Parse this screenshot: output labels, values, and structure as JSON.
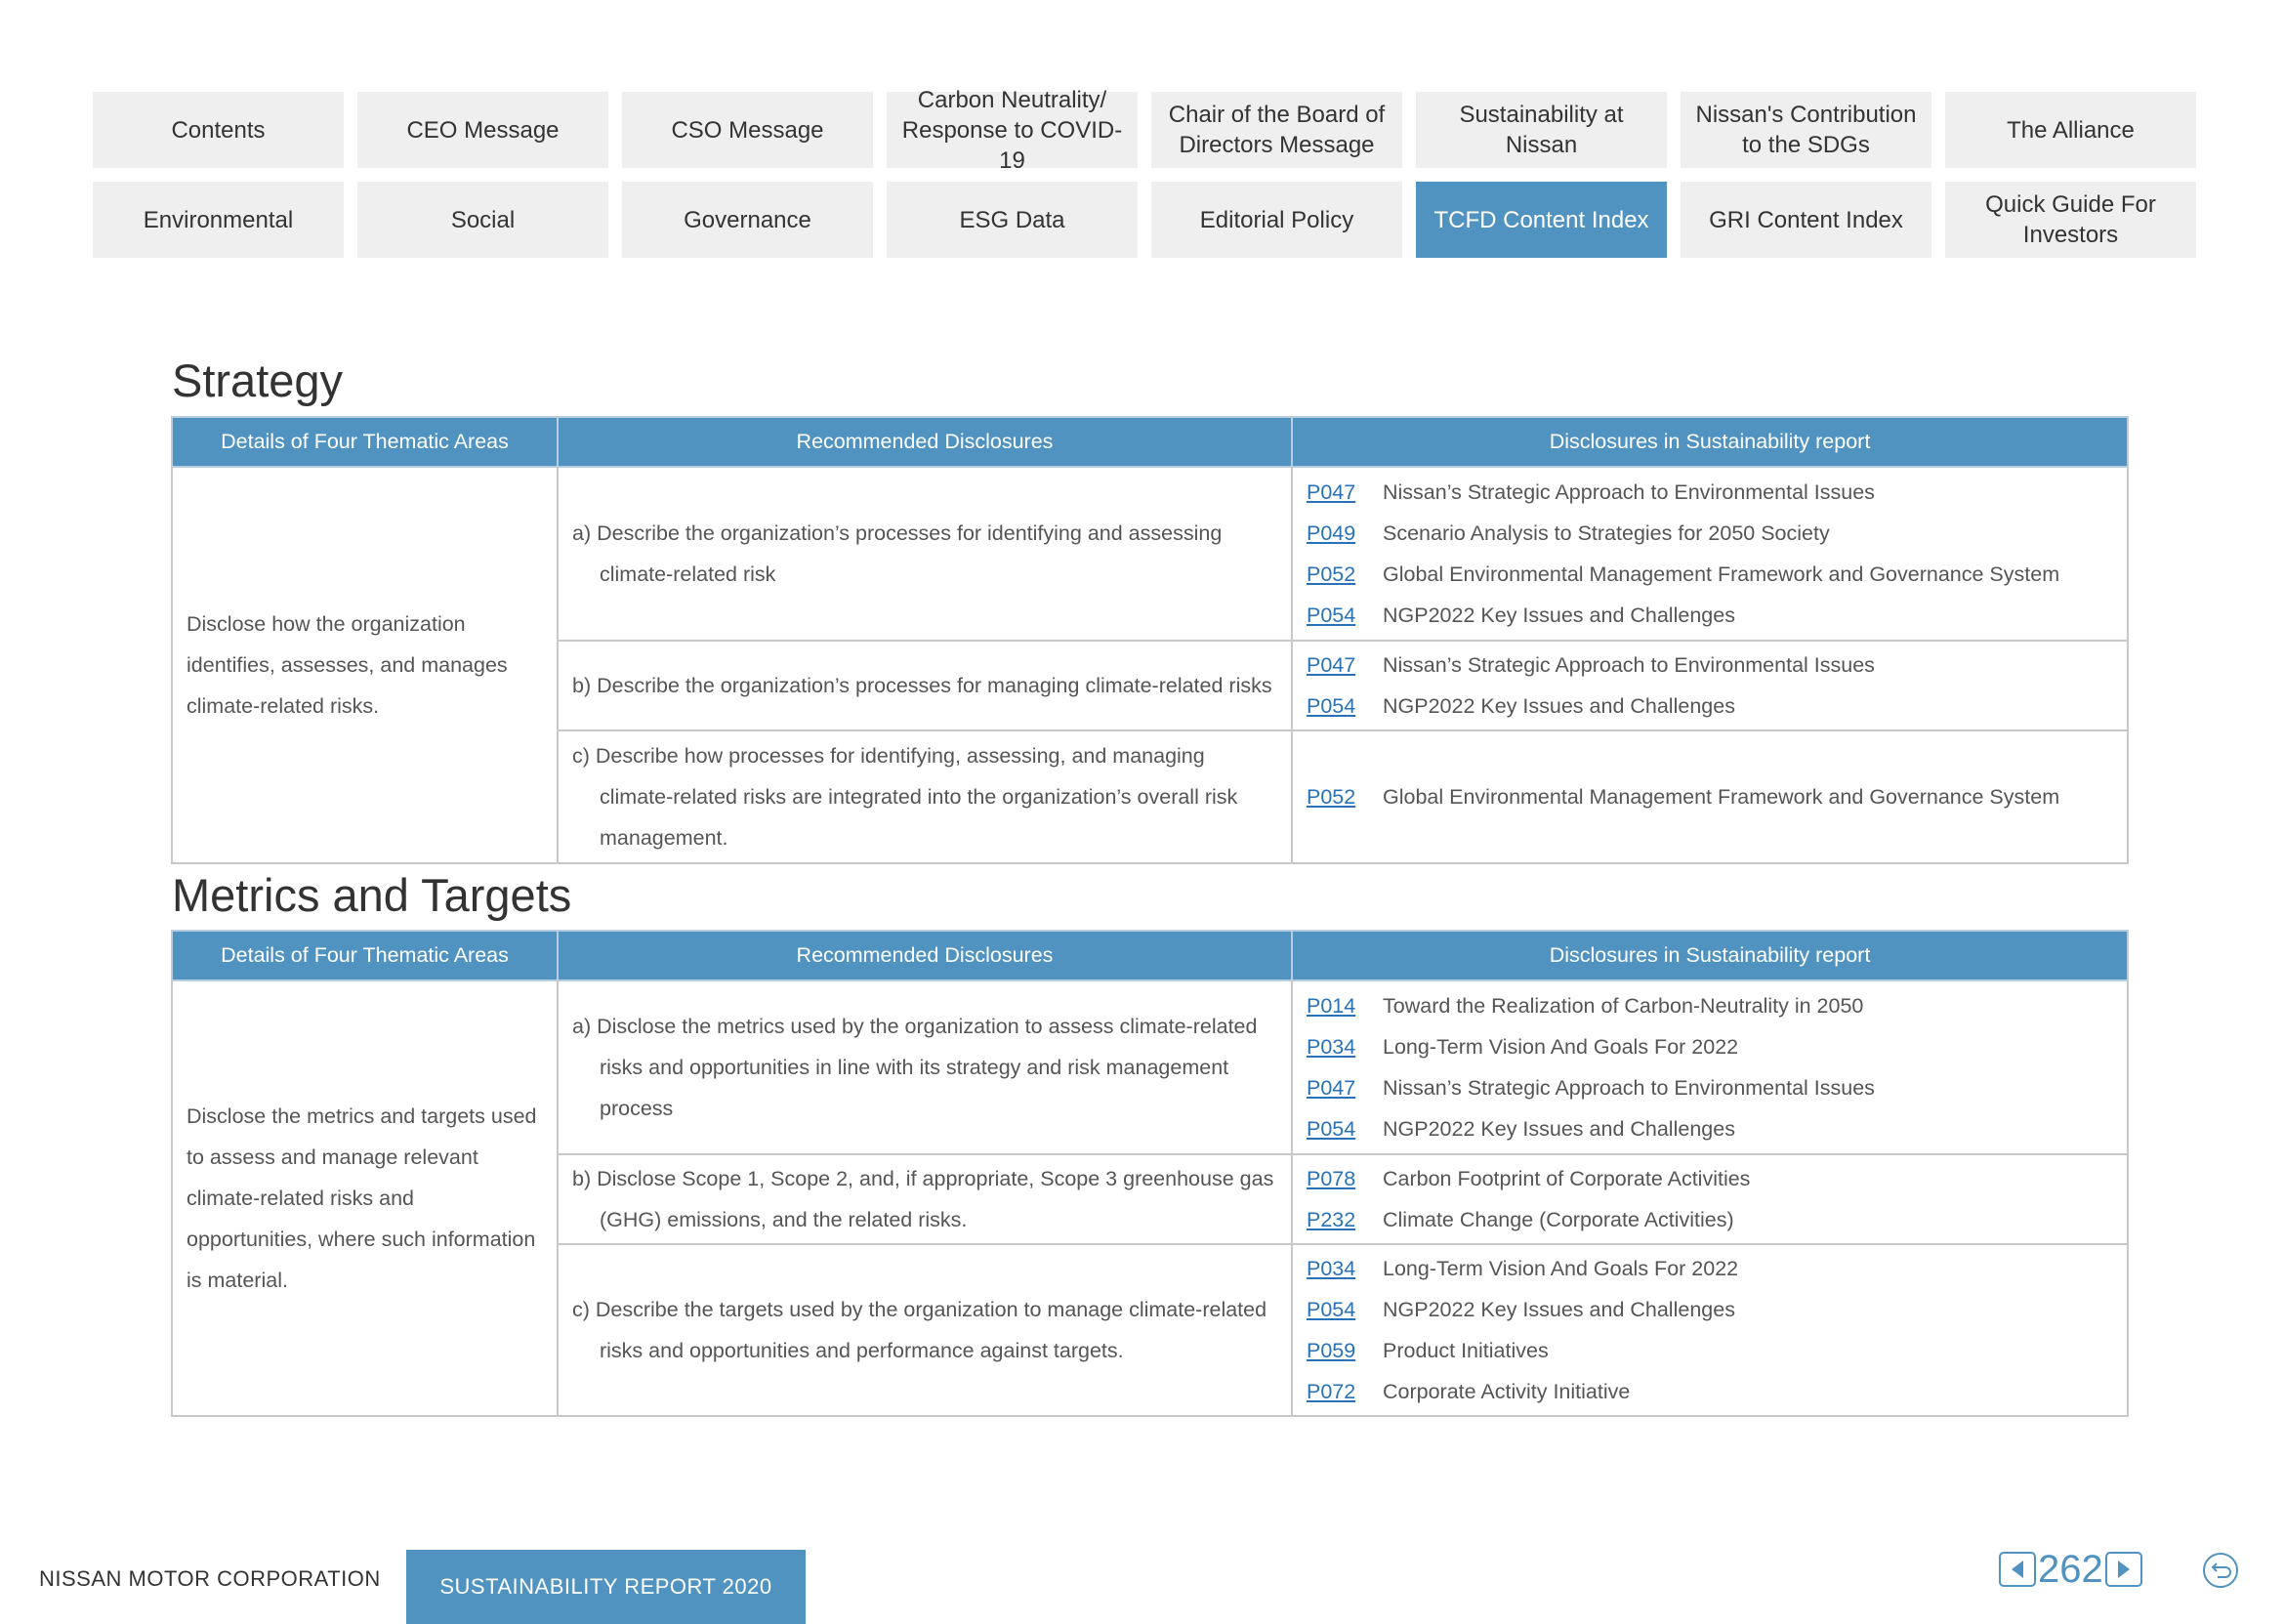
{
  "nav": {
    "row1": [
      "Contents",
      "CEO Message",
      "CSO Message",
      "Carbon Neutrality/\nResponse to COVID-19",
      "Chair of the Board of\nDirectors Message",
      "Sustainability at Nissan",
      "Nissan's Contribution\nto the SDGs",
      "The Alliance"
    ],
    "row2": [
      "Environmental",
      "Social",
      "Governance",
      "ESG Data",
      "Editorial Policy",
      "TCFD Content Index",
      "GRI Content Index",
      "Quick Guide For\nInvestors"
    ],
    "active": "TCFD Content Index"
  },
  "headers": {
    "col1": "Details of Four Thematic Areas",
    "col2": "Recommended Disclosures",
    "col3": "Disclosures in Sustainability report"
  },
  "strategy": {
    "title": "Strategy",
    "area": "Disclose how the organization identifies, assesses, and manages climate-related risks.",
    "rows": [
      {
        "rec": "a) Describe the organization’s processes for identifying and assessing climate-related risk",
        "refs": [
          {
            "code": "P047",
            "text": "Nissan’s Strategic Approach to Environmental Issues"
          },
          {
            "code": "P049",
            "text": "Scenario Analysis to Strategies for 2050 Society"
          },
          {
            "code": "P052",
            "text": "Global Environmental Management Framework and Governance System"
          },
          {
            "code": "P054",
            "text": "NGP2022 Key Issues and Challenges"
          }
        ]
      },
      {
        "rec": "b) Describe the organization’s processes for managing climate-related risks",
        "refs": [
          {
            "code": "P047",
            "text": "Nissan’s Strategic Approach to Environmental Issues"
          },
          {
            "code": "P054",
            "text": "NGP2022 Key Issues and Challenges"
          }
        ]
      },
      {
        "rec": "c) Describe how processes for identifying, assessing, and managing climate-related risks are integrated into the organization’s overall risk management.",
        "refs": [
          {
            "code": "P052",
            "text": "Global Environmental Management Framework and Governance System"
          }
        ]
      }
    ]
  },
  "metrics": {
    "title": "Metrics and Targets",
    "area": "Disclose the metrics and targets used to assess and manage relevant climate-related risks and opportunities, where such information is material.",
    "rows": [
      {
        "rec": "a) Disclose the metrics used by the organization to assess climate-related risks and opportunities in line with its strategy and risk management process",
        "refs": [
          {
            "code": "P014",
            "text": "Toward the Realization of Carbon-Neutrality in 2050"
          },
          {
            "code": "P034",
            "text": "Long-Term Vision And Goals For 2022"
          },
          {
            "code": "P047",
            "text": "Nissan’s Strategic Approach to Environmental Issues"
          },
          {
            "code": "P054",
            "text": "NGP2022 Key Issues and Challenges"
          }
        ]
      },
      {
        "rec": "b) Disclose Scope 1, Scope 2, and, if appropriate, Scope 3 greenhouse gas (GHG) emissions, and the related risks.",
        "refs": [
          {
            "code": "P078",
            "text": "Carbon Footprint of Corporate Activities"
          },
          {
            "code": "P232",
            "text": "Climate Change (Corporate Activities)"
          }
        ]
      },
      {
        "rec": "c) Describe the targets used by the organization to manage climate-related risks and opportunities and performance against targets.",
        "refs": [
          {
            "code": "P034",
            "text": "Long-Term Vision And Goals For 2022"
          },
          {
            "code": "P054",
            "text": "NGP2022 Key Issues and Challenges"
          },
          {
            "code": "P059",
            "text": "Product Initiatives"
          },
          {
            "code": "P072",
            "text": "Corporate Activity Initiative"
          }
        ]
      }
    ]
  },
  "footer": {
    "company": "NISSAN MOTOR CORPORATION",
    "report": "SUSTAINABILITY REPORT 2020",
    "page": "262"
  },
  "icons": {
    "prev": "prev-page-icon",
    "next": "next-page-icon",
    "back": "back-icon"
  },
  "colors": {
    "accent": "#5093c1",
    "link": "#2a72b8",
    "nav_bg": "#efefef"
  }
}
